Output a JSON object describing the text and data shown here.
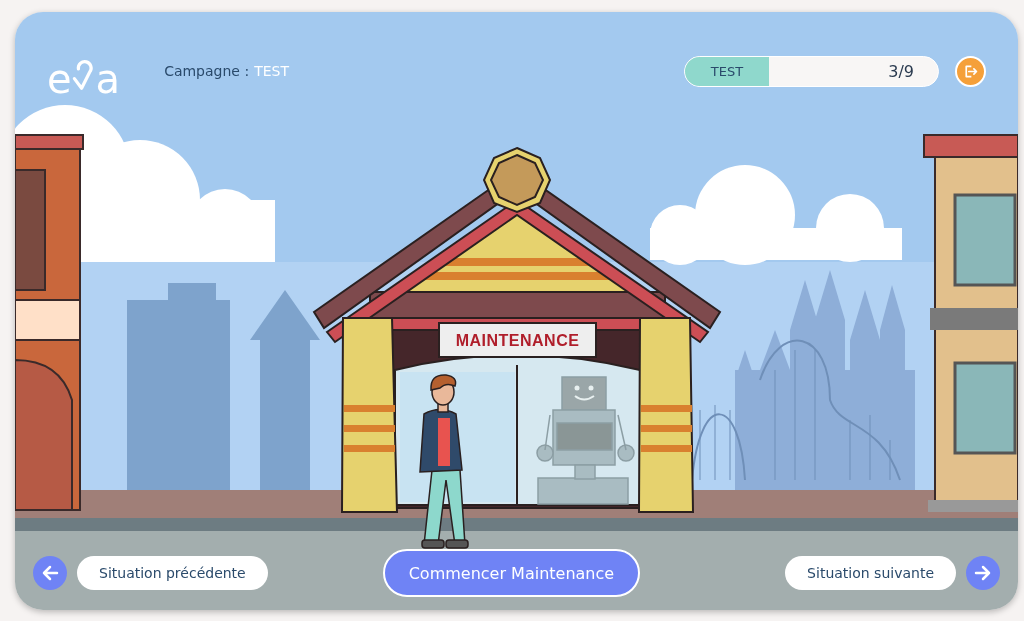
{
  "logo": {
    "left": "e",
    "right": "a"
  },
  "campaign": {
    "label": "Campagne :",
    "value": "TEST"
  },
  "progress": {
    "label": "TEST",
    "level": 0.333,
    "count": "3/9"
  },
  "scene": {
    "sign": "MAINTENANCE"
  },
  "navigation": {
    "previous": "Situation précédente",
    "action": "Commencer Maintenance",
    "next": "Situation suivante"
  }
}
